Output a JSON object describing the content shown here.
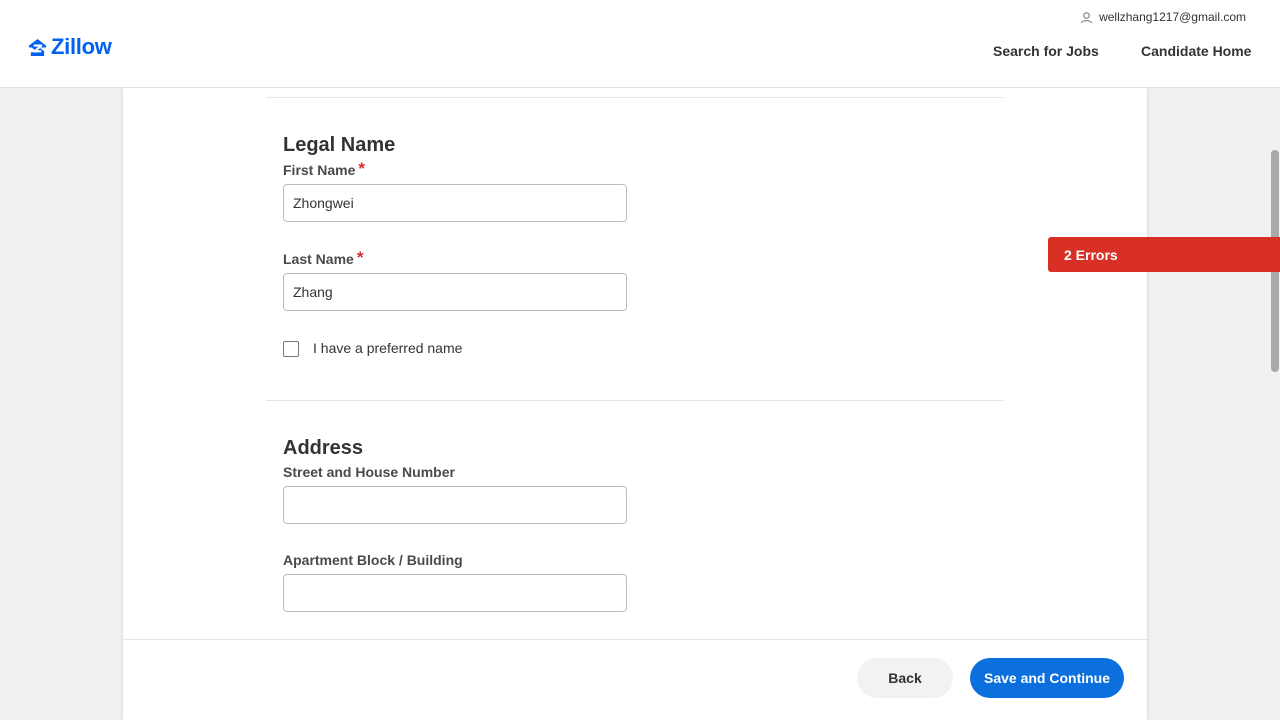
{
  "header": {
    "logo_text": "Zillow",
    "user_email": "wellzhang1217@gmail.com",
    "links": {
      "search_jobs": "Search for Jobs",
      "candidate_home": "Candidate Home"
    }
  },
  "errors_banner": "2 Errors",
  "legal_name": {
    "title": "Legal Name",
    "first_name_label": "First Name",
    "first_name_value": "Zhongwei",
    "last_name_label": "Last Name",
    "last_name_value": "Zhang",
    "required_mark": "*",
    "preferred_label": "I have a preferred name"
  },
  "address": {
    "title": "Address",
    "street_label": "Street and House Number",
    "street_value": "",
    "building_label": "Apartment Block / Building",
    "building_value": ""
  },
  "footer": {
    "back_label": "Back",
    "save_label": "Save and Continue"
  },
  "colors": {
    "brand": "#0061f2",
    "primary_button": "#0b6fde",
    "error": "#d93025",
    "required": "#d32f2f"
  }
}
